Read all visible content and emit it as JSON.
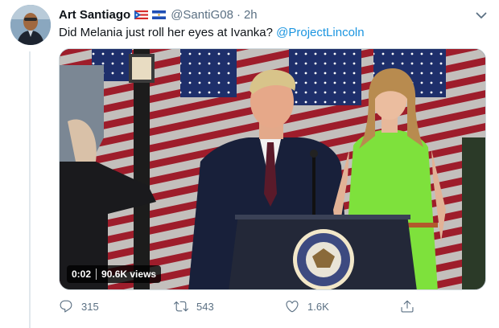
{
  "tweet": {
    "display_name": "Art Santiago",
    "flags": [
      "puerto-rico-flag",
      "el-salvador-flag"
    ],
    "handle": "@SantiG08",
    "separator": "·",
    "time": "2h",
    "text_plain": "Did Melania just roll her eyes at Ivanka? ",
    "text_mention": "@ProjectLincoln"
  },
  "video": {
    "time": "0:02",
    "views": "90.6K views"
  },
  "actions": {
    "reply_count": "315",
    "retweet_count": "543",
    "like_count": "1.6K"
  },
  "icons": {
    "more": "chevron-down-icon",
    "reply": "reply-icon",
    "retweet": "retweet-icon",
    "like": "heart-icon",
    "share": "share-icon"
  },
  "colors": {
    "text": "#0f1419",
    "secondary": "#5b7083",
    "mention": "#1b95e0",
    "dress": "#7ee13c",
    "flag_red": "#c3202f",
    "flag_blue": "#1e2f6b"
  }
}
